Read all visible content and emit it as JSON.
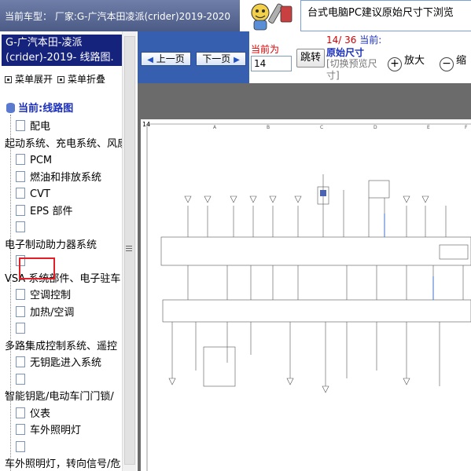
{
  "header": {
    "title": "当前车型： 厂家:G-广汽本田凌派(crider)2019-2020",
    "notice": "台式电脑PC建议原始尺寸下浏览"
  },
  "sidebar": {
    "title": "G-广汽本田-凌派(crider)-2019- 线路图.",
    "expand_label": "菜单展开",
    "collapse_label": "菜单折叠",
    "root_label": "当前:线路图",
    "items": [
      {
        "label": "配电",
        "type": "item"
      },
      {
        "label": "起动系统、充电系统、风扇",
        "type": "cat"
      },
      {
        "label": "PCM",
        "type": "item"
      },
      {
        "label": "燃油和排放系统",
        "type": "item"
      },
      {
        "label": "CVT",
        "type": "item",
        "selected": true
      },
      {
        "label": "EPS 部件",
        "type": "item"
      },
      {
        "label": "",
        "type": "item"
      },
      {
        "label": "电子制动助力器系统",
        "type": "cat"
      },
      {
        "label": "",
        "type": "item"
      },
      {
        "label": "VSA 系统部件、电子驻车",
        "type": "cat"
      },
      {
        "label": "空调控制",
        "type": "item"
      },
      {
        "label": "加热/空调",
        "type": "item"
      },
      {
        "label": "",
        "type": "item"
      },
      {
        "label": "多路集成控制系统、遥控",
        "type": "cat"
      },
      {
        "label": "无钥匙进入系统",
        "type": "item"
      },
      {
        "label": "",
        "type": "item"
      },
      {
        "label": "智能钥匙/电动车门门锁/",
        "type": "cat"
      },
      {
        "label": "仪表",
        "type": "item"
      },
      {
        "label": "车外照明灯",
        "type": "item"
      },
      {
        "label": "",
        "type": "item"
      },
      {
        "label": "车外照明灯，转向信号/危",
        "type": "cat"
      },
      {
        "label": "",
        "type": "item"
      }
    ]
  },
  "toolbar": {
    "prev_label": "上一页",
    "next_label": "下一页",
    "current_label": "当前为",
    "current_page_value": "14",
    "jump_label": "跳转",
    "page_current": "14/ 36",
    "page_suffix": "当前:",
    "original_size_label": "原始尺寸",
    "switch_preview_label": "[切换预览尺寸]",
    "zoom_in_label": "放大",
    "zoom_out_label": "缩"
  },
  "viewer": {
    "page_number": "14",
    "labels": [
      "A",
      "B",
      "C",
      "D",
      "E",
      "F"
    ]
  },
  "colors": {
    "title_bar": "#4c5b86",
    "sidebar_title": "#16237d",
    "nav_area": "#375fb0",
    "highlight": "#e21f26",
    "viewer_bg": "#6b6b6b"
  }
}
